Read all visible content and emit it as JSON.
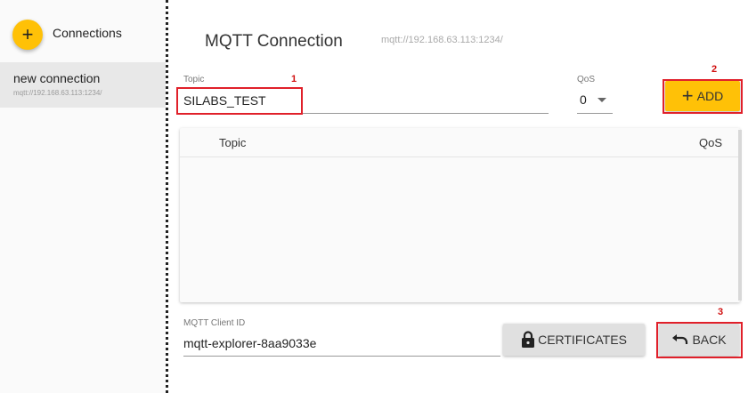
{
  "sidebar": {
    "fab_symbol": "+",
    "title": "Connections",
    "items": [
      {
        "name": "new connection",
        "url": "mqtt://192.168.63.113:1234/"
      }
    ]
  },
  "main": {
    "title": "MQTT Connection",
    "url": "mqtt://192.168.63.113:1234/"
  },
  "subscribe": {
    "topic_label": "Topic",
    "topic_value": "SILABS_TEST",
    "qos_label": "QoS",
    "qos_value": "0",
    "add_label": "ADD",
    "add_symbol": "+"
  },
  "table": {
    "columns": [
      "Topic",
      "QoS"
    ],
    "rows": []
  },
  "client": {
    "label": "MQTT Client ID",
    "value": "mqtt-explorer-8aa9033e"
  },
  "buttons": {
    "certificates": "CERTIFICATES",
    "back": "BACK"
  },
  "annotations": [
    "1",
    "2",
    "3"
  ],
  "colors": {
    "accent": "#ffc107",
    "annotation": "#e0202a",
    "button_grey": "#e0e0e0"
  },
  "icons": {
    "fab": "plus-icon",
    "add": "plus-icon",
    "certificates": "lock-icon",
    "back": "undo-icon",
    "qos": "caret-down-icon"
  }
}
